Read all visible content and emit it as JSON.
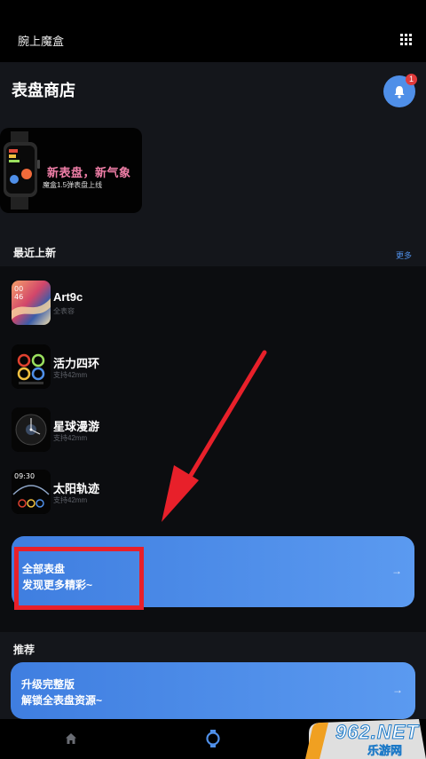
{
  "header": {
    "app_name": "腕上魔盒",
    "menu_icon": "grid-icon"
  },
  "store": {
    "title": "表盘商店",
    "notification_count": "1"
  },
  "banner": {
    "title": "新表盘，新气象",
    "subtitle": "魔盒1.5弹表盘上线"
  },
  "recent": {
    "section_title": "最近上新",
    "more_label": "更多",
    "items": [
      {
        "name": "Art9c",
        "sub": "全表容"
      },
      {
        "name": "活力四环",
        "sub": "支持42mm"
      },
      {
        "name": "星球漫游",
        "sub": "支持42mm"
      },
      {
        "name": "太阳轨迹",
        "sub": "支持42mm"
      }
    ],
    "thumb_texts": {
      "art_time_h": "00",
      "art_time_m": "46",
      "sun_time": "09:30"
    }
  },
  "cta_all": {
    "line1": "全部表盘",
    "line2": "发现更多精彩~",
    "arrow": "→"
  },
  "recommend": {
    "section_title": "推荐",
    "cta": {
      "line1": "升级完整版",
      "line2": "解锁全表盘资源~",
      "arrow": "→"
    }
  },
  "bottom_nav": {
    "home_icon": "home-icon",
    "watch_icon": "watch-icon"
  },
  "watermark": {
    "brand": "962.NET",
    "sub": "乐游网"
  },
  "colors": {
    "accent": "#4f8fe8",
    "annotation": "#e8202a",
    "background": "#14161b"
  }
}
